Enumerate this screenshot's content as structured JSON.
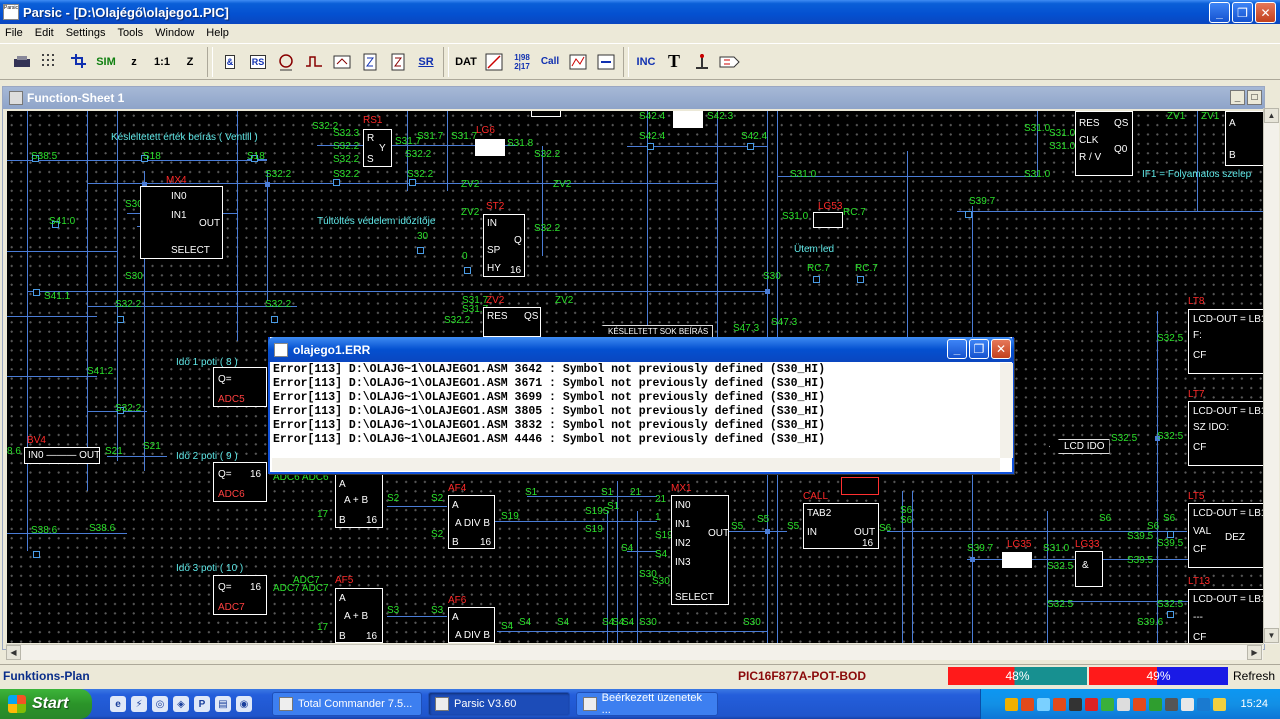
{
  "window": {
    "title": "Parsic - [D:\\Olajégő\\olajego1.PIC]",
    "app_icon_text": "Parsic",
    "buttons": {
      "minimize": "_",
      "restore": "❐",
      "close": "✕"
    }
  },
  "menu": [
    "File",
    "Edit",
    "Settings",
    "Tools",
    "Window",
    "Help"
  ],
  "toolbar": {
    "btn_sim": "SIM",
    "btn_z": "z",
    "btn_1to1": "1:1",
    "btn_Z": "Z",
    "btn_and": "&",
    "btn_rs": "RS",
    "btn_dat": "DAT",
    "btn_frac": "1|98 2|17",
    "btn_call": "Call",
    "btn_sr": "SR",
    "btn_inc": "INC",
    "btn_T": "T"
  },
  "sheet": {
    "title": "Function-Sheet 1",
    "icon_text": "Parsic"
  },
  "canvas": {
    "labels": {
      "keslelt": "Késleltetett érték beírás ( Ventill )",
      "tultoltes": "Túltöltés védelem időzítője",
      "utem": "Ütem led",
      "ido1": "Idő 1 poti ( 8 )",
      "ido2": "Idő 2 poti ( 9 )",
      "ido3": "Idő 3 poti ( 10 )",
      "if1": "IF1 = Folyamatos szelep",
      "keslelt_sok": "KÉSLELTETT SOK BEÍRÁS",
      "lcd_ido": "LCD IDO"
    },
    "names": {
      "mx4": "MX4",
      "rs1": "RS1",
      "lg6": "LG6",
      "st2": "ST2",
      "zv2": "ZV2",
      "lg53": "LG53",
      "bv4": "BV4",
      "af4": "AF4",
      "mx1": "MX1",
      "call": "CALL",
      "af5": "AF5",
      "af6": "AF6",
      "lg35": "LG35",
      "lg33": "LG33",
      "lt8": "LT8",
      "lt7": "LT7",
      "lt5": "LT5",
      "lt13": "LT13",
      "zv1": "ZV1"
    },
    "pins": {
      "in0": "IN0",
      "in1": "IN1",
      "in2": "IN2",
      "in3": "IN3",
      "out": "OUT",
      "select": "SELECT",
      "r": "R",
      "s": "S",
      "y": "Y",
      "in": "IN",
      "sp": "SP",
      "hy": "HY",
      "q": "Q",
      "res": "RES",
      "qs": "QS",
      "clk": "CLK",
      "rv": "R / V",
      "q0": "Q0",
      "qeq": "Q=",
      "a": "A",
      "b": "B",
      "apb": "A + B",
      "adivb": "A DIV B",
      "tab2": "TAB2",
      "amp": "&",
      "lcdout": "LCD-OUT = LB1",
      "f": "F:",
      "cf": "CF",
      "szido": "SZ IDO:",
      "val": "VAL",
      "dez": "DEZ",
      "dashes": "---",
      "inout": "IN0 ——— OUT"
    },
    "nums": {
      "n16": "16",
      "n17": "17",
      "n30": "30",
      "n0": "0",
      "n21": "21",
      "n1": "1"
    },
    "adc": {
      "adc5": "ADC5",
      "adc6": "ADC6",
      "adc7": "ADC7",
      "adc6_2": "ADC6 ADC6",
      "adc7_2": "ADC7 ADC7"
    },
    "signals": {
      "s385": "S38.5",
      "s18": "S18",
      "s410": "S41.0",
      "s30": "S30",
      "s411": "S41.1",
      "s322": "S32.2",
      "s412": "S41.2",
      "s21": "S21",
      "s386": "S38.6",
      "s323": "S32.3",
      "s317": "S31.7",
      "s318": "S31.8",
      "s424": "S42.4",
      "s423": "S42.3",
      "s310": "S31.0",
      "s397": "S39.7",
      "rc7": "RC.7",
      "s473": "S47.3",
      "s325": "S32.5",
      "s5": "S5",
      "s6": "S6",
      "s19": "S19",
      "s4": "S4",
      "s3": "S3",
      "s2": "S2",
      "s395": "S39.5",
      "s396": "S39.6",
      "s1": "S1",
      "s20": "S20",
      "s195": "S19S",
      "86": "8.6"
    }
  },
  "error_dialog": {
    "title": "olajego1.ERR",
    "lines": [
      "Error[113]   D:\\OLAJG~1\\OLAJEGO1.ASM 3642 : Symbol not previously defined (S30_HI)",
      "Error[113]   D:\\OLAJG~1\\OLAJEGO1.ASM 3671 : Symbol not previously defined (S30_HI)",
      "Error[113]   D:\\OLAJG~1\\OLAJEGO1.ASM 3699 : Symbol not previously defined (S30_HI)",
      "Error[113]   D:\\OLAJG~1\\OLAJEGO1.ASM 3805 : Symbol not previously defined (S30_HI)",
      "Error[113]   D:\\OLAJG~1\\OLAJEGO1.ASM 3832 : Symbol not previously defined (S30_HI)",
      "Error[113]   D:\\OLAJG~1\\OLAJEGO1.ASM 4446 : Symbol not previously defined (S30_HI)"
    ]
  },
  "statusbar": {
    "mode": "Funktions-Plan",
    "device": "PIC16F877A-POT-BOD",
    "gauge1": "48%",
    "gauge1_value": 0.48,
    "gauge2": "49%",
    "gauge2_value": 0.49,
    "refresh": "Refresh"
  },
  "taskbar": {
    "start": "Start",
    "tasks": [
      "Total Commander 7.5...",
      "Parsic V3.60",
      "Beérkezett üzenetek ..."
    ],
    "clock": "15:24"
  },
  "colors": {
    "accent": "#0450d0",
    "wire": "#4a7cd6",
    "signal": "#2be02b",
    "name": "#ff2a2a"
  }
}
